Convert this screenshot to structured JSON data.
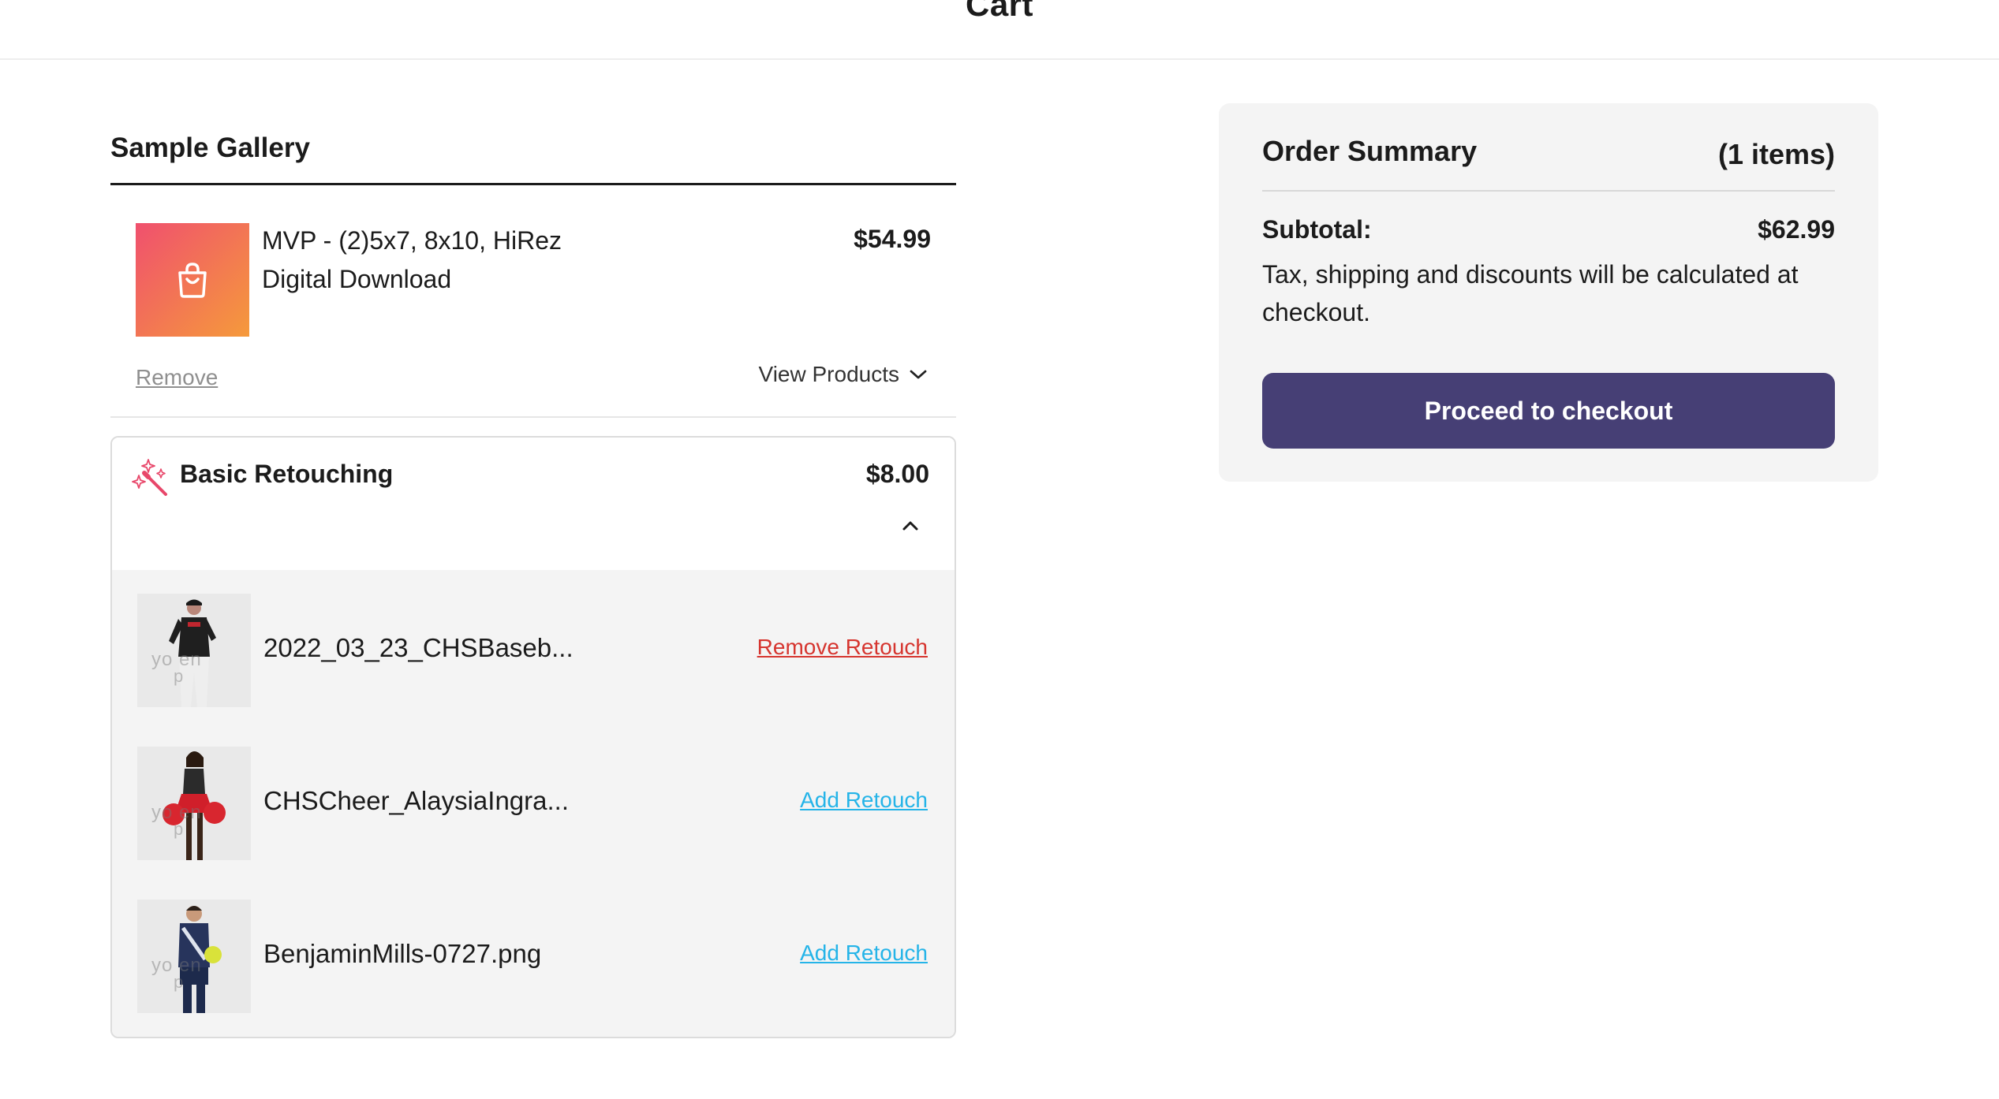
{
  "header": {
    "title": "Cart"
  },
  "gallery": {
    "title": "Sample Gallery",
    "item": {
      "name_line1": "MVP - (2)5x7, 8x10, HiRez",
      "name_line2": "Digital Download",
      "price": "$54.99",
      "remove_label": "Remove",
      "view_products_label": "View Products",
      "thumb_icon": "shopping-bag-icon"
    }
  },
  "retouching": {
    "title": "Basic Retouching",
    "price": "$8.00",
    "icon": "magic-wand-icon",
    "photos": [
      {
        "filename": "2022_03_23_CHSBaseb...",
        "action": "Remove Retouch"
      },
      {
        "filename": "CHSCheer_AlaysiaIngra...",
        "action": "Add Retouch"
      },
      {
        "filename": "BenjaminMills-0727.png",
        "action": "Add Retouch"
      }
    ]
  },
  "summary": {
    "title": "Order Summary",
    "count": "(1 items)",
    "subtotal_label": "Subtotal:",
    "subtotal_value": "$62.99",
    "note": "Tax, shipping and discounts will be calculated at checkout.",
    "checkout_label": "Proceed to checkout"
  },
  "colors": {
    "checkout_button": "#463f75",
    "remove_retouch": "#d6352f",
    "add_retouch": "#25b4e8",
    "summary_bg": "#f4f4f4"
  }
}
